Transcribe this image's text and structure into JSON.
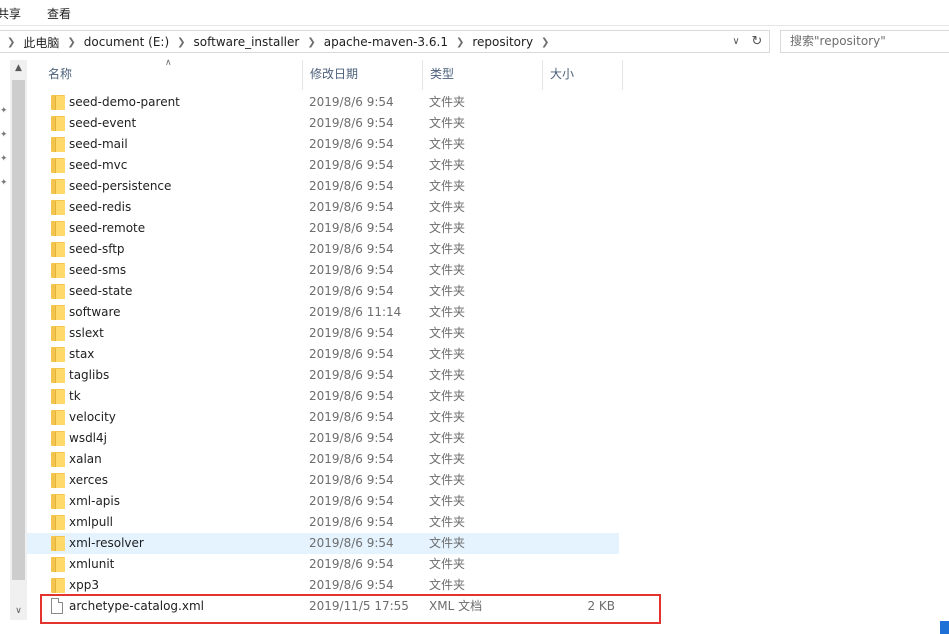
{
  "ribbon": {
    "tabs": [
      "共享",
      "查看"
    ]
  },
  "address": {
    "crumbs": [
      "此电脑",
      "document (E:)",
      "software_installer",
      "apache-maven-3.6.1",
      "repository"
    ],
    "search_placeholder": "搜索\"repository\""
  },
  "columns": {
    "name": "名称",
    "date": "修改日期",
    "type": "类型",
    "size": "大小"
  },
  "files": [
    {
      "name": "seed-demo-parent",
      "date": "2019/8/6 9:54",
      "type": "文件夹",
      "size": "",
      "kind": "folder"
    },
    {
      "name": "seed-event",
      "date": "2019/8/6 9:54",
      "type": "文件夹",
      "size": "",
      "kind": "folder"
    },
    {
      "name": "seed-mail",
      "date": "2019/8/6 9:54",
      "type": "文件夹",
      "size": "",
      "kind": "folder"
    },
    {
      "name": "seed-mvc",
      "date": "2019/8/6 9:54",
      "type": "文件夹",
      "size": "",
      "kind": "folder"
    },
    {
      "name": "seed-persistence",
      "date": "2019/8/6 9:54",
      "type": "文件夹",
      "size": "",
      "kind": "folder"
    },
    {
      "name": "seed-redis",
      "date": "2019/8/6 9:54",
      "type": "文件夹",
      "size": "",
      "kind": "folder"
    },
    {
      "name": "seed-remote",
      "date": "2019/8/6 9:54",
      "type": "文件夹",
      "size": "",
      "kind": "folder"
    },
    {
      "name": "seed-sftp",
      "date": "2019/8/6 9:54",
      "type": "文件夹",
      "size": "",
      "kind": "folder"
    },
    {
      "name": "seed-sms",
      "date": "2019/8/6 9:54",
      "type": "文件夹",
      "size": "",
      "kind": "folder"
    },
    {
      "name": "seed-state",
      "date": "2019/8/6 9:54",
      "type": "文件夹",
      "size": "",
      "kind": "folder"
    },
    {
      "name": "software",
      "date": "2019/8/6 11:14",
      "type": "文件夹",
      "size": "",
      "kind": "folder"
    },
    {
      "name": "sslext",
      "date": "2019/8/6 9:54",
      "type": "文件夹",
      "size": "",
      "kind": "folder"
    },
    {
      "name": "stax",
      "date": "2019/8/6 9:54",
      "type": "文件夹",
      "size": "",
      "kind": "folder"
    },
    {
      "name": "taglibs",
      "date": "2019/8/6 9:54",
      "type": "文件夹",
      "size": "",
      "kind": "folder"
    },
    {
      "name": "tk",
      "date": "2019/8/6 9:54",
      "type": "文件夹",
      "size": "",
      "kind": "folder"
    },
    {
      "name": "velocity",
      "date": "2019/8/6 9:54",
      "type": "文件夹",
      "size": "",
      "kind": "folder"
    },
    {
      "name": "wsdl4j",
      "date": "2019/8/6 9:54",
      "type": "文件夹",
      "size": "",
      "kind": "folder"
    },
    {
      "name": "xalan",
      "date": "2019/8/6 9:54",
      "type": "文件夹",
      "size": "",
      "kind": "folder"
    },
    {
      "name": "xerces",
      "date": "2019/8/6 9:54",
      "type": "文件夹",
      "size": "",
      "kind": "folder"
    },
    {
      "name": "xml-apis",
      "date": "2019/8/6 9:54",
      "type": "文件夹",
      "size": "",
      "kind": "folder"
    },
    {
      "name": "xmlpull",
      "date": "2019/8/6 9:54",
      "type": "文件夹",
      "size": "",
      "kind": "folder"
    },
    {
      "name": "xml-resolver",
      "date": "2019/8/6 9:54",
      "type": "文件夹",
      "size": "",
      "kind": "folder",
      "hover": true
    },
    {
      "name": "xmlunit",
      "date": "2019/8/6 9:54",
      "type": "文件夹",
      "size": "",
      "kind": "folder"
    },
    {
      "name": "xpp3",
      "date": "2019/8/6 9:54",
      "type": "文件夹",
      "size": "",
      "kind": "folder"
    },
    {
      "name": "archetype-catalog.xml",
      "date": "2019/11/5 17:55",
      "type": "XML 文档",
      "size": "2 KB",
      "kind": "file"
    }
  ],
  "colors": {
    "highlight": "#e4332f",
    "hover_row": "#e5f3ff",
    "folder": "#ffd96a"
  }
}
